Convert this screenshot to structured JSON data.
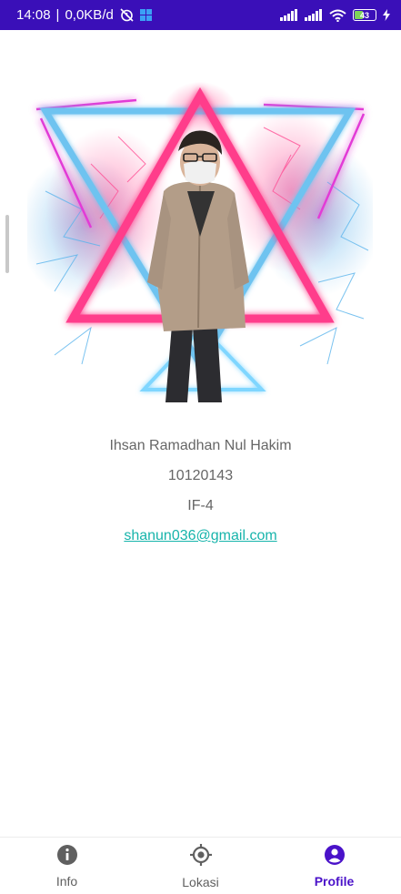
{
  "status_bar": {
    "time": "14:08",
    "network_speed": "0,0KB/d",
    "battery_level": "43",
    "icons": [
      "alarm-off-icon",
      "windows-icon",
      "signal-icon",
      "signal-icon",
      "wifi-icon",
      "battery-icon",
      "charging-icon"
    ]
  },
  "profile": {
    "name": "Ihsan Ramadhan Nul Hakim",
    "nim": "10120143",
    "class": "IF-4",
    "email": "shanun036@gmail.com"
  },
  "bottom_nav": {
    "items": [
      {
        "label": "Info",
        "icon": "info-icon"
      },
      {
        "label": "Lokasi",
        "icon": "location-target-icon"
      },
      {
        "label": "Profile",
        "icon": "person-circle-icon"
      }
    ],
    "active": "Profile"
  },
  "colors": {
    "status_bar": "#3a0fb8",
    "accent": "#4a12c9",
    "link": "#17b4ab",
    "neon_pink": "#ff3d8b",
    "neon_blue": "#6ec3f0"
  }
}
